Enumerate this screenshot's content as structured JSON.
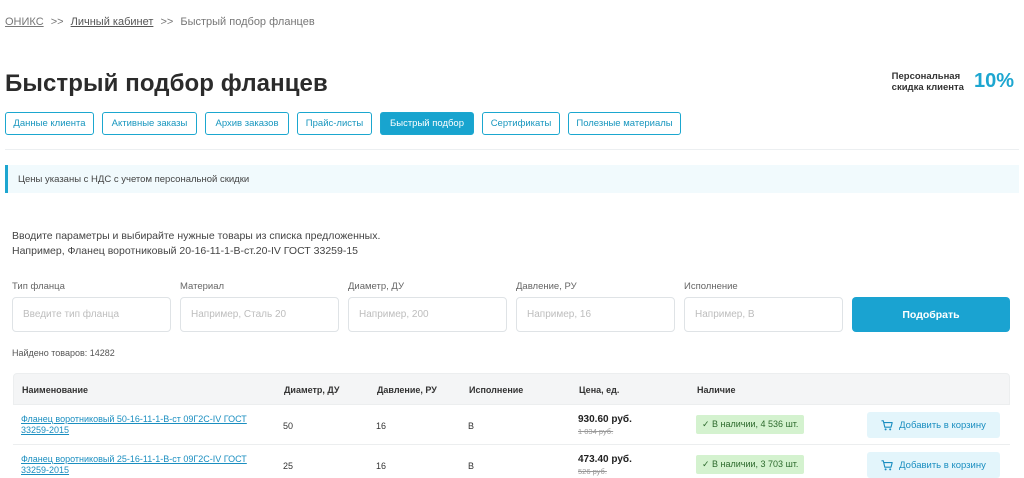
{
  "breadcrumb": {
    "root": "ОНИКС",
    "sep1": ">>",
    "cabinet": "Личный кабинет",
    "sep2": ">>",
    "current": "Быстрый подбор фланцев"
  },
  "page_title": "Быстрый подбор фланцев",
  "discount": {
    "label_line1": "Персональная",
    "label_line2": "скидка клиента",
    "value": "10%"
  },
  "tabs": [
    {
      "label": "Данные клиента",
      "active": false
    },
    {
      "label": "Активные заказы",
      "active": false
    },
    {
      "label": "Архив заказов",
      "active": false
    },
    {
      "label": "Прайс-листы",
      "active": false
    },
    {
      "label": "Быстрый подбор",
      "active": true
    },
    {
      "label": "Сертификаты",
      "active": false
    },
    {
      "label": "Полезные материалы",
      "active": false
    }
  ],
  "notice": "Цены указаны с НДС с учетом персональной скидки",
  "intro": {
    "line1": "Вводите параметры и выбирайте нужные товары из списка предложенных.",
    "line2": "Например, Фланец воротниковый 20-16-11-1-В-ст.20-IV ГОСТ 33259-15"
  },
  "filters": [
    {
      "label": "Тип фланца",
      "placeholder": "Введите тип фланца",
      "value": ""
    },
    {
      "label": "Материал",
      "placeholder": "Например, Сталь 20",
      "value": ""
    },
    {
      "label": "Диаметр, ДУ",
      "placeholder": "Например, 200",
      "value": ""
    },
    {
      "label": "Давление, РУ",
      "placeholder": "Например, 16",
      "value": ""
    },
    {
      "label": "Исполнение",
      "placeholder": "Например, В",
      "value": ""
    }
  ],
  "search_button": "Подобрать",
  "found": "Найдено товаров: 14282",
  "table": {
    "columns": [
      "Наименование",
      "Диаметр, ДУ",
      "Давление, РУ",
      "Исполнение",
      "Цена, ед.",
      "Наличие"
    ],
    "rows": [
      {
        "name": "Фланец воротниковый 50-16-11-1-В-ст 09Г2С-IV ГОСТ 33259-2015",
        "diameter": "50",
        "pressure": "16",
        "execution": "В",
        "price": "930.60 руб.",
        "old_price": "1 034 руб.",
        "stock": "✓ В наличии, 4 536 шт.",
        "cart": "Добавить в корзину"
      },
      {
        "name": "Фланец воротниковый 25-16-11-1-В-ст 09Г2С-IV ГОСТ 33259-2015",
        "diameter": "25",
        "pressure": "16",
        "execution": "В",
        "price": "473.40 руб.",
        "old_price": "526 руб.",
        "stock": "✓ В наличии, 3 703 шт.",
        "cart": "Добавить в корзину"
      }
    ]
  },
  "colors": {
    "accent": "#1aa3d1",
    "stock_bg": "#d4f2cf",
    "notice_bg": "#f1fafd"
  }
}
